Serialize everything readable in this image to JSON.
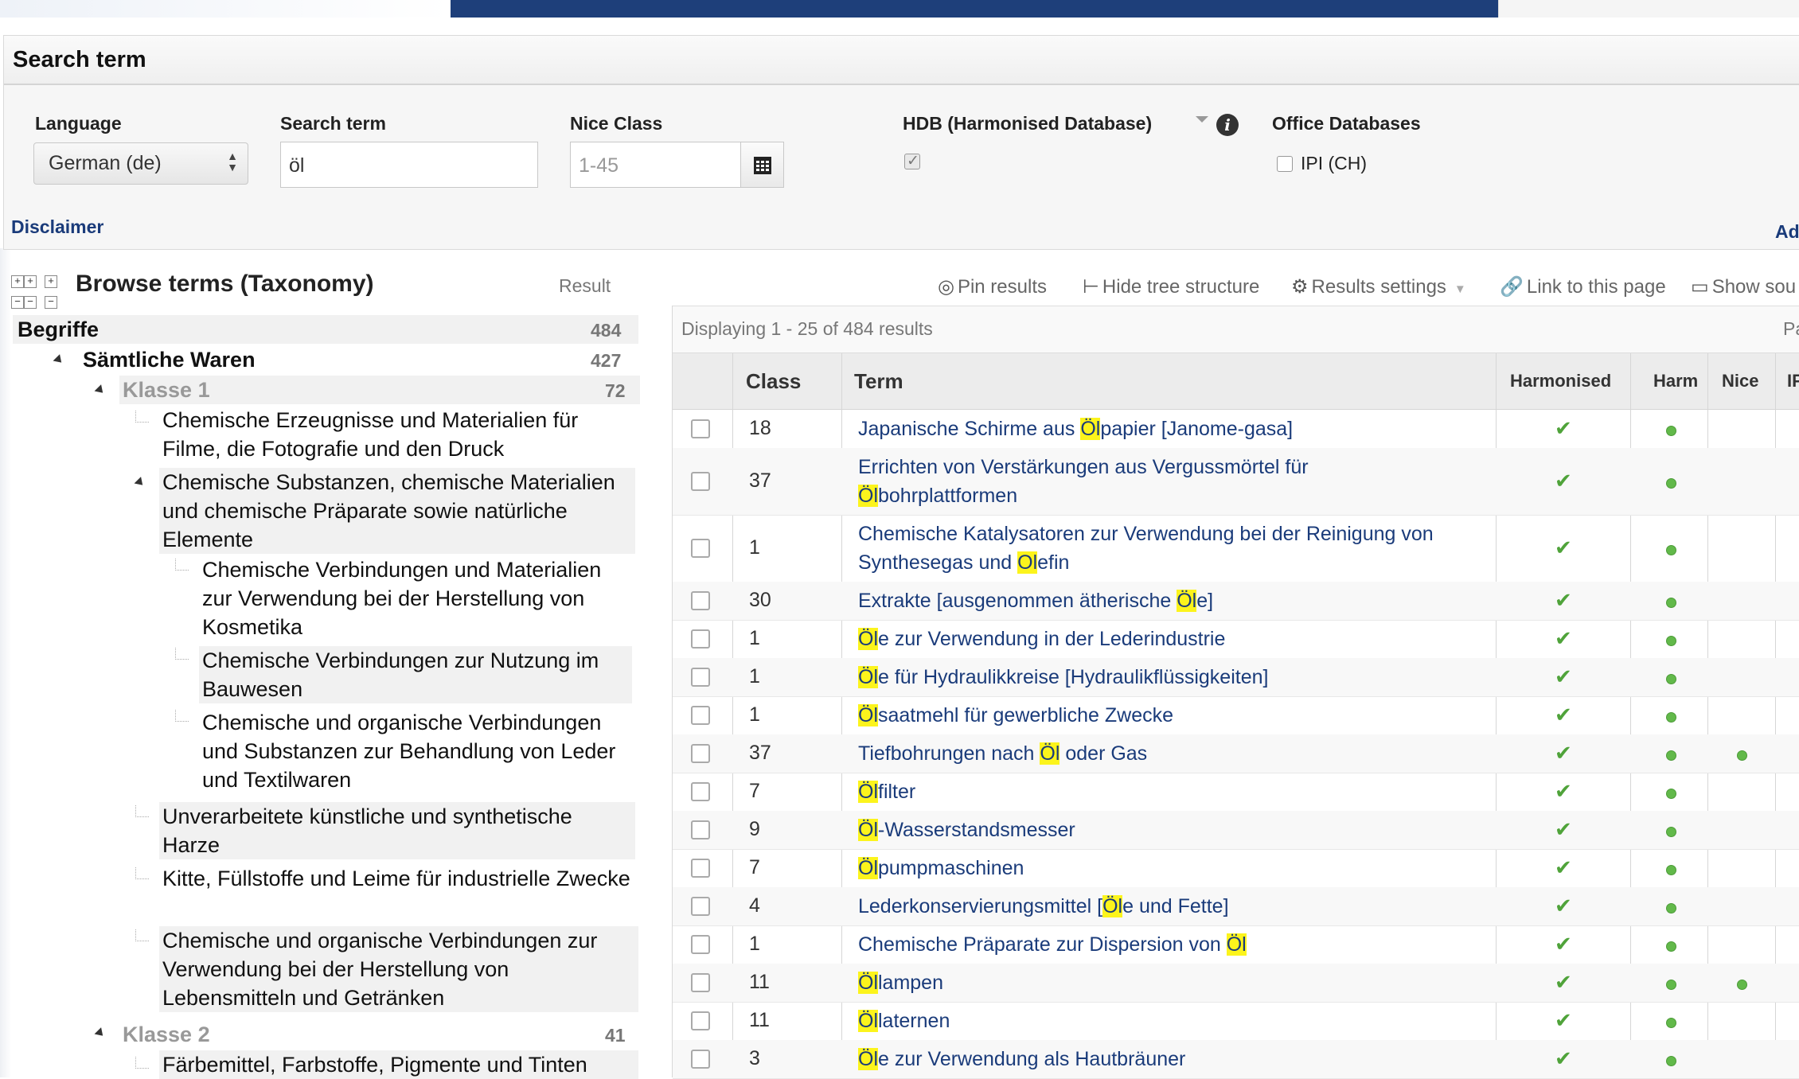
{
  "search_panel": {
    "title": "Search term",
    "language_label": "Language",
    "language_value": "German (de)",
    "search_term_label": "Search term",
    "search_term_value": "öl",
    "nice_class_label": "Nice Class",
    "nice_class_placeholder": "1-45",
    "hdb_label": "HDB (Harmonised Database)",
    "office_db_label": "Office Databases",
    "office_db_option": "IPI (CH)",
    "disclaimer": "Disclaimer",
    "right_link": "Ad"
  },
  "taxonomy": {
    "title": "Browse terms (Taxonomy)",
    "result_label": "Result",
    "items": [
      {
        "label": "Begriffe",
        "count": "484"
      },
      {
        "label": "Sämtliche Waren",
        "count": "427"
      },
      {
        "label": "Klasse 1",
        "count": "72"
      },
      {
        "label": "Chemische Erzeugnisse und Materialien für Filme, die Fotografie und den Druck"
      },
      {
        "label": "Chemische Substanzen, chemische Materialien und chemische Präparate sowie natürliche Elemente"
      },
      {
        "label": "Chemische Verbindungen und Materialien zur Verwendung bei der Herstellung von Kosmetika"
      },
      {
        "label": "Chemische Verbindungen zur Nutzung im Bauwesen"
      },
      {
        "label": "Chemische und organische Verbindungen und Substanzen zur Behandlung von Leder und Textilwaren"
      },
      {
        "label": "Unverarbeitete künstliche und synthetische Harze"
      },
      {
        "label": "Kitte, Füllstoffe und Leime für industrielle Zwecke"
      },
      {
        "label": "Chemische und organische Verbindungen zur Verwendung bei der Herstellung von Lebensmitteln und Getränken"
      },
      {
        "label": "Klasse 2",
        "count": "41"
      },
      {
        "label": "Färbemittel, Farbstoffe, Pigmente und Tinten"
      }
    ]
  },
  "toolbar": {
    "pin": "Pin results",
    "hide_tree": "Hide tree structure",
    "settings": "Results settings",
    "link": "Link to this page",
    "show_source": "Show sou"
  },
  "results": {
    "displaying": "Displaying 1 - 25 of 484 results",
    "page_label": "Pa",
    "headers": {
      "class": "Class",
      "term": "Term",
      "harmonised": "Harmonised",
      "harm": "Harm",
      "nice": "Nice",
      "ip": "IP"
    },
    "rows": [
      {
        "class": "18",
        "pre": "Japanische Schirme aus ",
        "hl": "Öl",
        "post": "papier [Janome-gasa]",
        "nice": false
      },
      {
        "class": "37",
        "pre": "Errichten von Verstärkungen aus Vergussmörtel für ",
        "hl": "Öl",
        "post": "bohrplattformen",
        "nice": false
      },
      {
        "class": "1",
        "pre": "Chemische Katalysatoren zur Verwendung bei der Reinigung von Synthesegas und ",
        "hl": "Ol",
        "post": "efin",
        "nice": false
      },
      {
        "class": "30",
        "pre": "Extrakte [ausgenommen ätherische ",
        "hl": "Öl",
        "post": "e]",
        "nice": false
      },
      {
        "class": "1",
        "pre": "",
        "hl": "Öl",
        "post": "e zur Verwendung in der Lederindustrie",
        "nice": false
      },
      {
        "class": "1",
        "pre": "",
        "hl": "Öl",
        "post": "e für Hydraulikkreise [Hydraulikflüssigkeiten]",
        "nice": false
      },
      {
        "class": "1",
        "pre": "",
        "hl": "Öl",
        "post": "saatmehl für gewerbliche Zwecke",
        "nice": false
      },
      {
        "class": "37",
        "pre": "Tiefbohrungen nach ",
        "hl": "Öl",
        "post": " oder Gas",
        "nice": true
      },
      {
        "class": "7",
        "pre": "",
        "hl": "Öl",
        "post": "filter",
        "nice": false
      },
      {
        "class": "9",
        "pre": "",
        "hl": "Öl",
        "post": "-Wasserstandsmesser",
        "nice": false
      },
      {
        "class": "7",
        "pre": "",
        "hl": "Öl",
        "post": "pumpmaschinen",
        "nice": false
      },
      {
        "class": "4",
        "pre": "Lederkonservierungsmittel [",
        "hl": "Öl",
        "post": "e und Fette]",
        "nice": false
      },
      {
        "class": "1",
        "pre": "Chemische Präparate zur Dispersion von ",
        "hl": "Öl",
        "post": "",
        "nice": false
      },
      {
        "class": "11",
        "pre": "",
        "hl": "Öl",
        "post": "lampen",
        "nice": true
      },
      {
        "class": "11",
        "pre": "",
        "hl": "Öl",
        "post": "laternen",
        "nice": false
      },
      {
        "class": "3",
        "pre": "",
        "hl": "Öl",
        "post": "e zur Verwendung als Hautbräuner",
        "nice": false
      }
    ]
  }
}
